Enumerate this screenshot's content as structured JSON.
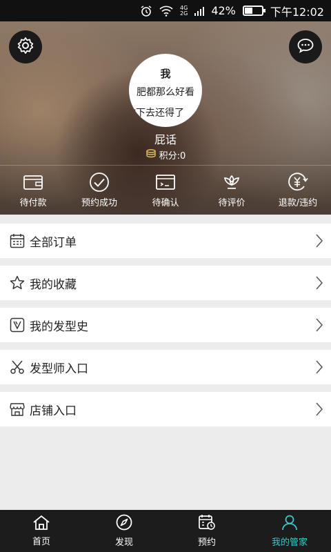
{
  "status_bar": {
    "network_top": "4G",
    "network_bottom": "2G",
    "battery": "42%",
    "battery_level": 0.42,
    "time": "下午12:02"
  },
  "header": {
    "avatar_lines": [
      "我",
      "肥都那么好看",
      "你下去还得了"
    ],
    "nickname": "屁话",
    "points": "积分:0"
  },
  "order_status": [
    {
      "label": "待付款",
      "icon": "wallet-icon"
    },
    {
      "label": "预约成功",
      "icon": "check-circle-icon"
    },
    {
      "label": "待确认",
      "icon": "window-icon"
    },
    {
      "label": "待评价",
      "icon": "lotus-icon"
    },
    {
      "label": "退款/违约",
      "icon": "yen-refresh-icon"
    }
  ],
  "menu": [
    {
      "label": "全部订单",
      "icon": "calendar-list-icon"
    },
    {
      "label": "我的收藏",
      "icon": "star-icon"
    },
    {
      "label": "我的发型史",
      "icon": "hairstyle-history-icon"
    },
    {
      "label": "发型师入口",
      "icon": "scissors-icon"
    },
    {
      "label": "店铺入口",
      "icon": "shop-icon"
    }
  ],
  "tabs": [
    {
      "label": "首页",
      "icon": "home-icon"
    },
    {
      "label": "发现",
      "icon": "compass-icon"
    },
    {
      "label": "预约",
      "icon": "calendar-clock-icon"
    },
    {
      "label": "我的管家",
      "icon": "person-icon"
    }
  ],
  "colors": {
    "accent": "#3ac6c8",
    "tabbar_bg": "#1c1c1c",
    "status_bg": "#111111"
  }
}
